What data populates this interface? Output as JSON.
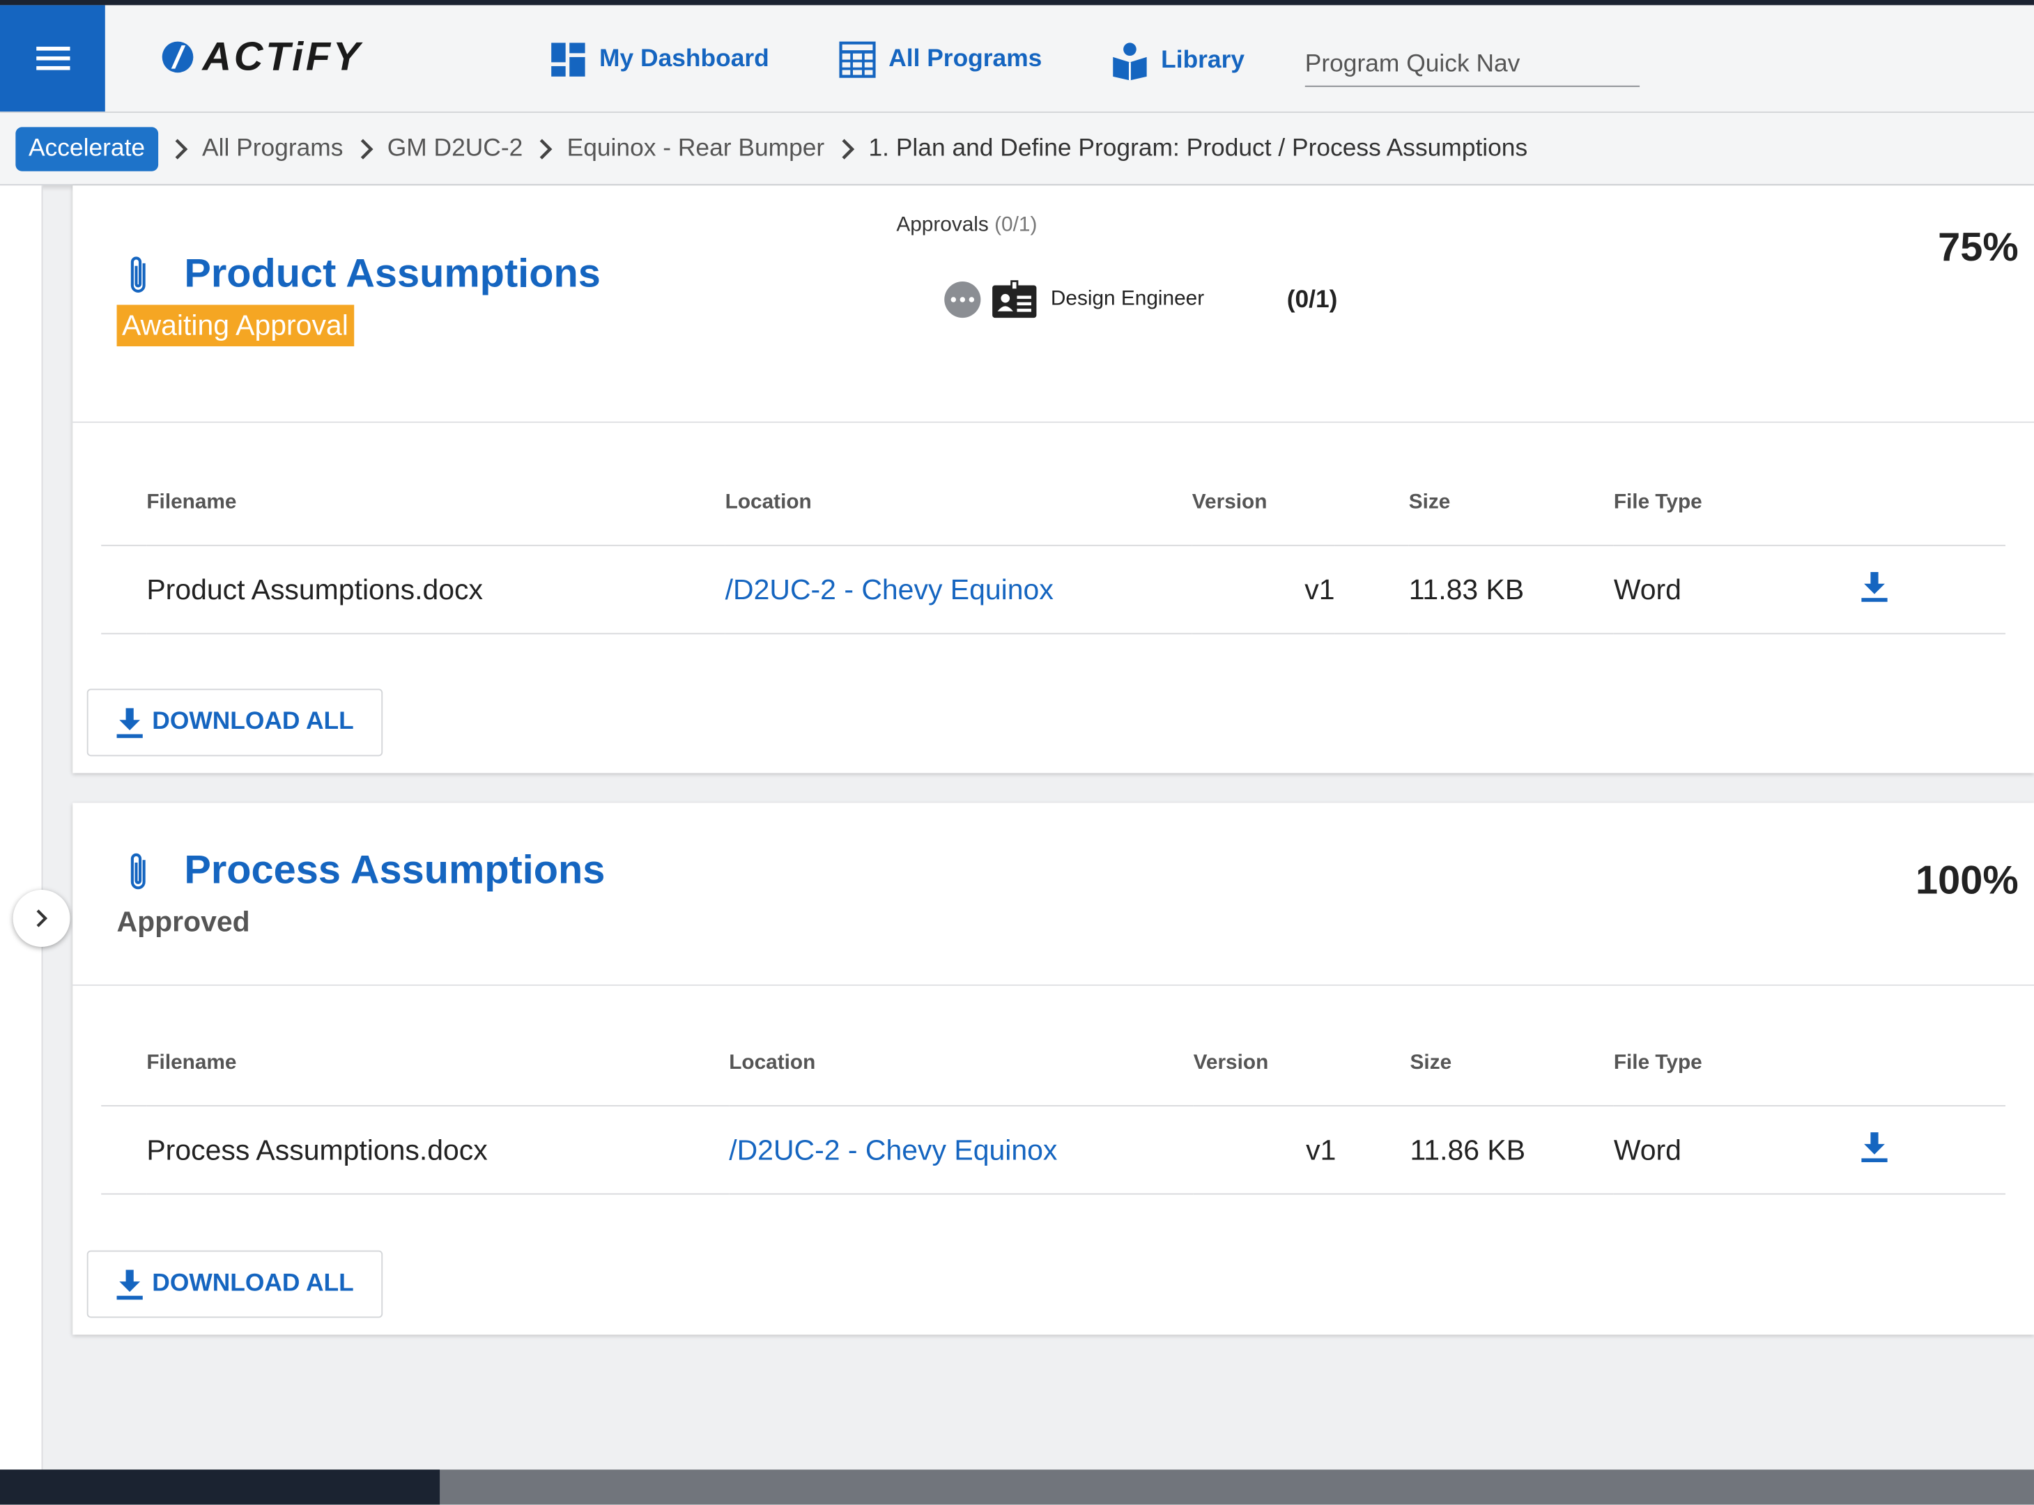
{
  "app": {
    "logo_text": "ACTiFY",
    "brand_color": "#1565c0"
  },
  "nav": {
    "items": [
      {
        "label": "My Dashboard",
        "icon": "dashboard-icon"
      },
      {
        "label": "All Programs",
        "icon": "grid-icon"
      },
      {
        "label": "Library",
        "icon": "book-icon"
      }
    ],
    "quick_nav_placeholder": "Program Quick Nav"
  },
  "breadcrumb": {
    "badge": "Accelerate",
    "items": [
      "All Programs",
      "GM D2UC-2",
      "Equinox - Rear Bumper",
      "1. Plan and Define Program: Product / Process Assumptions"
    ]
  },
  "columns": {
    "filename": "Filename",
    "location": "Location",
    "version": "Version",
    "size": "Size",
    "filetype": "File Type"
  },
  "cards": [
    {
      "title": "Product Assumptions",
      "status": "Awaiting Approval",
      "status_color": "#f5a623",
      "percent": "75%",
      "approvals": {
        "label": "Approvals",
        "count": "(0/1)",
        "role": "Design Engineer",
        "role_count": "(0/1)"
      },
      "files": [
        {
          "filename": "Product Assumptions.docx",
          "location": "/D2UC-2 - Chevy Equinox",
          "version": "v1",
          "size": "11.83 KB",
          "filetype": "Word"
        }
      ],
      "download_all": "DOWNLOAD ALL"
    },
    {
      "title": "Process Assumptions",
      "status": "Approved",
      "percent": "100%",
      "files": [
        {
          "filename": "Process Assumptions.docx",
          "location": "/D2UC-2 - Chevy Equinox",
          "version": "v1",
          "size": "11.86 KB",
          "filetype": "Word"
        }
      ],
      "download_all": "DOWNLOAD ALL"
    }
  ]
}
